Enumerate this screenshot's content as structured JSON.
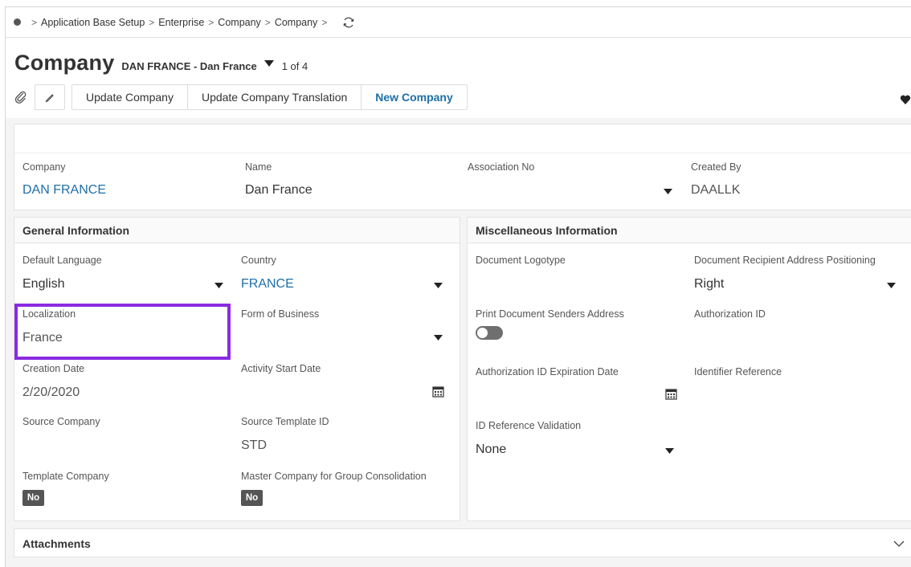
{
  "breadcrumb": {
    "items": [
      "Application Base Setup",
      "Enterprise",
      "Company",
      "Company"
    ],
    "separator": ">"
  },
  "header": {
    "title": "Company",
    "record_name": "DAN FRANCE - Dan France",
    "record_count": "1 of 4"
  },
  "toolbar": {
    "update_company": "Update Company",
    "update_translation": "Update Company Translation",
    "new_company": "New Company"
  },
  "summary": {
    "company_label": "Company",
    "company_value": "DAN FRANCE",
    "name_label": "Name",
    "name_value": "Dan France",
    "association_label": "Association No",
    "created_by_label": "Created By",
    "created_by_value": "DAALLK"
  },
  "general": {
    "title": "General Information",
    "default_language_label": "Default Language",
    "default_language_value": "English",
    "country_label": "Country",
    "country_value": "FRANCE",
    "localization_label": "Localization",
    "localization_value": "France",
    "form_of_business_label": "Form of Business",
    "creation_date_label": "Creation Date",
    "creation_date_value": "2/20/2020",
    "activity_start_label": "Activity Start Date",
    "source_company_label": "Source Company",
    "source_template_label": "Source Template ID",
    "source_template_value": "STD",
    "template_company_label": "Template Company",
    "template_company_value": "No",
    "master_company_label": "Master Company for Group Consolidation",
    "master_company_value": "No"
  },
  "misc": {
    "title": "Miscellaneous Information",
    "logotype_label": "Document Logotype",
    "recipient_pos_label": "Document Recipient Address Positioning",
    "recipient_pos_value": "Right",
    "print_senders_label": "Print Document Senders Address",
    "authorization_id_label": "Authorization ID",
    "auth_expiration_label": "Authorization ID Expiration Date",
    "identifier_ref_label": "Identifier Reference",
    "id_ref_validation_label": "ID Reference Validation",
    "id_ref_validation_value": "None"
  },
  "attachments": {
    "title": "Attachments"
  },
  "colors": {
    "link": "#1e6fa8",
    "highlight": "#8a2be2",
    "badge": "#555555"
  }
}
